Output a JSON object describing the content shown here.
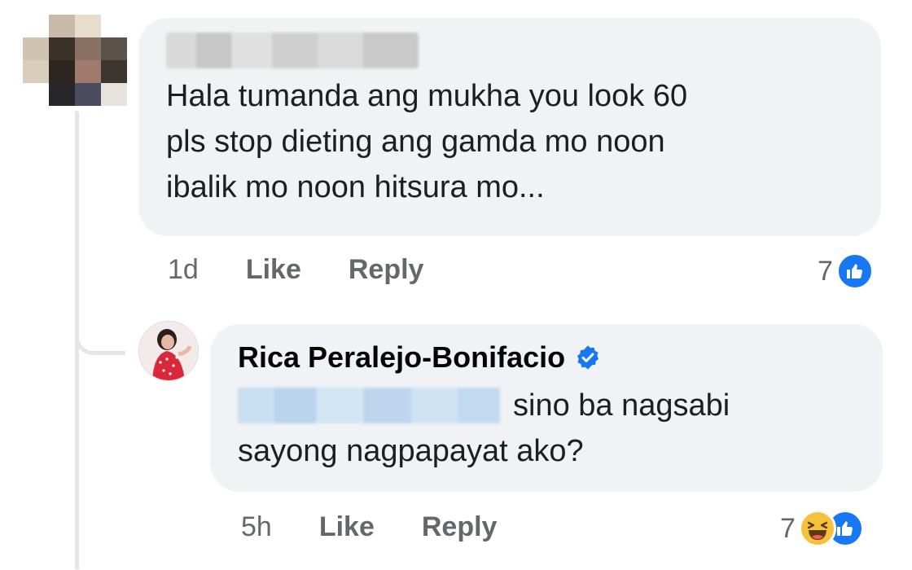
{
  "comment": {
    "text": "Hala tumanda ang mukha you look 60\npls stop dieting ang gamda mo noon\nibalik mo noon hitsura mo...",
    "time": "1d",
    "like_label": "Like",
    "reply_label": "Reply",
    "reaction_count": "7",
    "reaction_icons": [
      "like-icon"
    ]
  },
  "reply": {
    "author": "Rica Peralejo-Bonifacio",
    "verified_icon": "verified-badge-icon",
    "text_line1": "sino ba nagsabi",
    "text_line2": "sayong nagpapayat ako?",
    "time": "5h",
    "like_label": "Like",
    "reply_label": "Reply",
    "reaction_count": "7",
    "reaction_icons": [
      "haha-icon",
      "like-icon"
    ]
  },
  "colors": {
    "bubble": "#f0f2f5",
    "action_text": "#65676b",
    "like_blue": "#1877f2",
    "haha_yellow": "#f7c23b"
  }
}
